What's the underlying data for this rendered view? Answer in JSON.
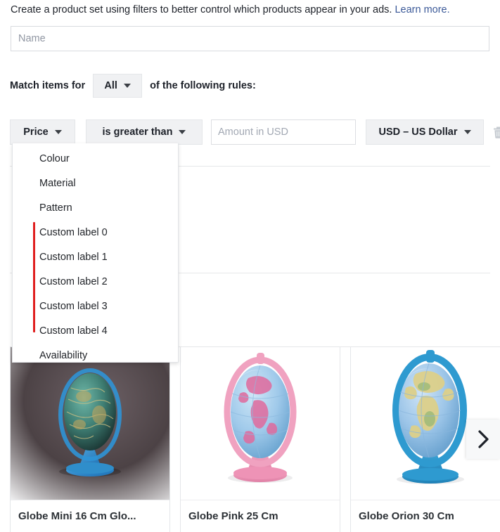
{
  "intro": {
    "text": "Create a product set using filters to better control which products appear in your ads. ",
    "link_label": "Learn more."
  },
  "name_field": {
    "placeholder": "Name",
    "value": ""
  },
  "match_row": {
    "label": "Match items for",
    "selected": "All",
    "suffix": "of the following rules:"
  },
  "rule_row": {
    "attribute": "Price",
    "operator": "is greater than",
    "amount_placeholder": "Amount in USD",
    "amount_value": "",
    "currency": "USD – US Dollar",
    "delete_icon": "trash-icon"
  },
  "dropdown": {
    "open": true,
    "items": [
      {
        "label": "Colour",
        "marked": false
      },
      {
        "label": "Material",
        "marked": false
      },
      {
        "label": "Pattern",
        "marked": false
      },
      {
        "label": "Custom label 0",
        "marked": true
      },
      {
        "label": "Custom label 1",
        "marked": true
      },
      {
        "label": "Custom label 2",
        "marked": true
      },
      {
        "label": "Custom label 3",
        "marked": true
      },
      {
        "label": "Custom label 4",
        "marked": true
      },
      {
        "label": "Availability",
        "marked": false
      }
    ]
  },
  "annotation": {
    "color": "#e02020",
    "covers": "Custom label 0 through Custom label 4"
  },
  "products": [
    {
      "title": "Globe Mini 16 Cm Glo...",
      "image": "globe-dark-mini"
    },
    {
      "title": "Globe Pink 25 Cm",
      "image": "globe-pink"
    },
    {
      "title": "Globe Orion 30 Cm",
      "image": "globe-orion-blue"
    }
  ],
  "carousel": {
    "next_label": "›",
    "next_icon": "chevron-right-icon"
  },
  "colors": {
    "link": "#3b5998",
    "text": "#1d2129",
    "button_bg": "#f0f1f3",
    "border": "#e4e6e9",
    "annotation_red": "#e02020"
  }
}
